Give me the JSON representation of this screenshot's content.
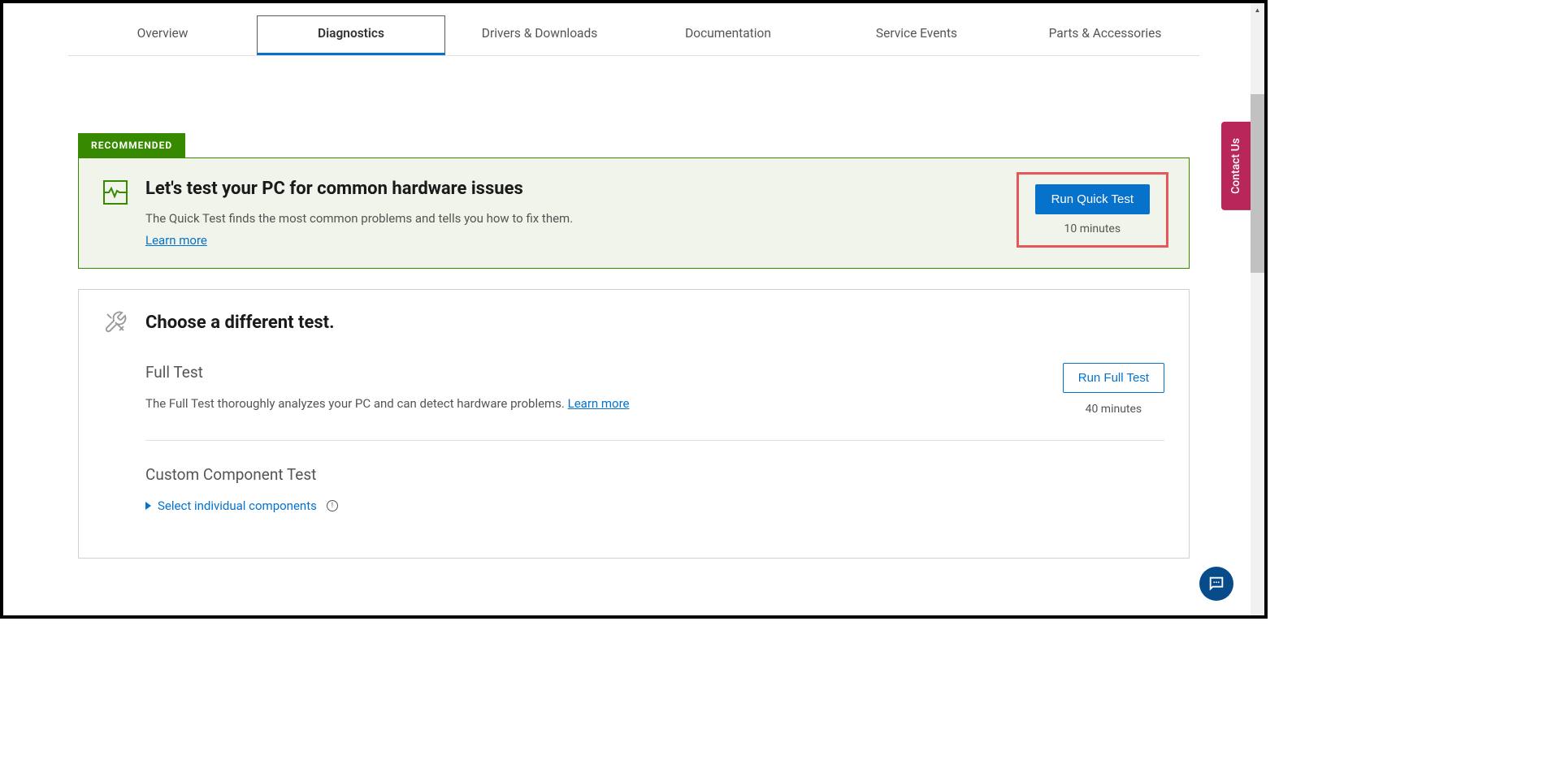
{
  "tabs": [
    {
      "label": "Overview"
    },
    {
      "label": "Diagnostics"
    },
    {
      "label": "Drivers & Downloads"
    },
    {
      "label": "Documentation"
    },
    {
      "label": "Service Events"
    },
    {
      "label": "Parts & Accessories"
    }
  ],
  "recommended": {
    "badge": "RECOMMENDED",
    "title": "Let's test your PC for common hardware issues",
    "description": "The Quick Test finds the most common problems and tells you how to fix them.",
    "learn_more": "Learn more",
    "button": "Run Quick Test",
    "duration": "10 minutes"
  },
  "different": {
    "title": "Choose a different test.",
    "full": {
      "title": "Full Test",
      "description": "The Full Test thoroughly analyzes your PC and can detect hardware problems. ",
      "learn_more": "Learn more",
      "button": "Run Full Test",
      "duration": "40 minutes"
    },
    "custom": {
      "title": "Custom Component Test",
      "expand": "Select individual components"
    }
  },
  "contact_us": "Contact Us"
}
